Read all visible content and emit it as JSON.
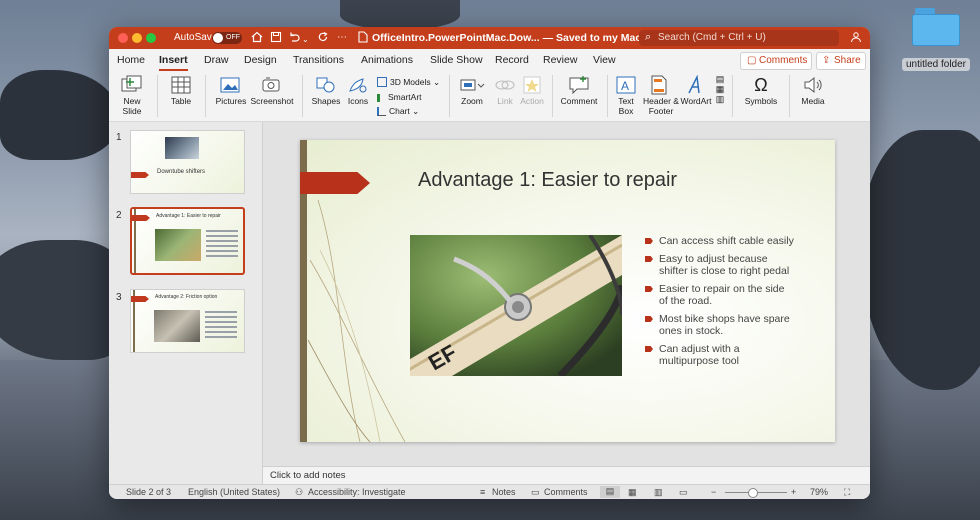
{
  "desktop": {
    "folder_label": "untitled folder"
  },
  "titlebar": {
    "autosave_label": "AutoSave",
    "autosave_state": "OFF",
    "doc_name": "OfficeIntro.PowerPointMac.Dow...",
    "saved_status": "— Saved to my Mac",
    "search_placeholder": "Search (Cmd + Ctrl + U)"
  },
  "tabs": [
    "Home",
    "Insert",
    "Draw",
    "Design",
    "Transitions",
    "Animations",
    "Slide Show",
    "Record",
    "Review",
    "View"
  ],
  "active_tab": "Insert",
  "actions": {
    "comments": "Comments",
    "share": "Share"
  },
  "ribbon": {
    "new_slide": "New Slide",
    "table": "Table",
    "pictures": "Pictures",
    "screenshot": "Screenshot",
    "shapes": "Shapes",
    "icons": "Icons",
    "models_3d": "3D Models",
    "smartart": "SmartArt",
    "chart": "Chart",
    "zoom": "Zoom",
    "link": "Link",
    "action": "Action",
    "comment": "Comment",
    "text_box": "Text Box",
    "header_footer": "Header & Footer",
    "wordart": "WordArt",
    "symbols": "Symbols",
    "media": "Media"
  },
  "thumbnails": [
    {
      "number": "1",
      "title": "Downtube shifters"
    },
    {
      "number": "2",
      "title": "Advantage 1: Easier to repair"
    },
    {
      "number": "3",
      "title": "Advantage 2: Friction option"
    }
  ],
  "slide": {
    "title": "Advantage 1: Easier to repair",
    "bullets": [
      "Can access shift cable easily",
      "Easy to adjust because shifter is close to right pedal",
      "Easier to repair on the side of the road.",
      "Most bike shops have spare ones in stock.",
      "Can adjust with a multipurpose tool"
    ]
  },
  "notes_placeholder": "Click to add notes",
  "status": {
    "slide_position": "Slide 2 of 3",
    "language": "English (United States)",
    "accessibility": "Accessibility: Investigate",
    "notes": "Notes",
    "comments": "Comments",
    "zoom_level": "79%",
    "zoom_fraction": 0.45
  },
  "colors": {
    "accent": "#c43e1c",
    "slide_accent": "#b8321b",
    "slide_bar": "#7b6c4c"
  }
}
